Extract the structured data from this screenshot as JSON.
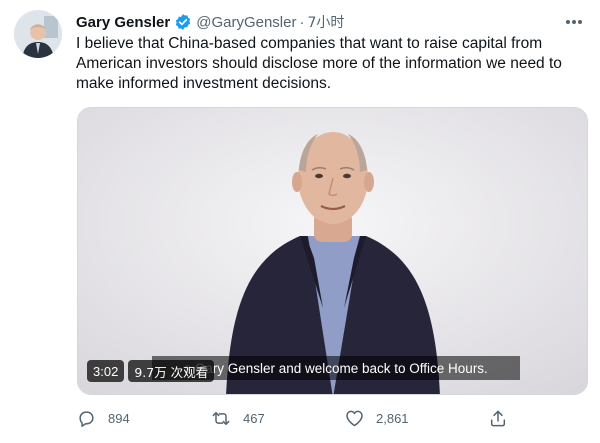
{
  "author": {
    "name": "Gary Gensler",
    "handle": "@GaryGensler",
    "separator": "·",
    "time": "7小时",
    "verified": true
  },
  "tweet": {
    "text": "I believe that China-based companies that want to raise capital from American investors should disclose more of the information we need to make informed investment decisions."
  },
  "video": {
    "subtitle": "s Gary Gensler and welcome back to Office Hours.",
    "duration": "3:02",
    "views": "9.7万 次观看"
  },
  "actions": {
    "replies": "894",
    "retweets": "467",
    "likes": "2,861"
  },
  "colors": {
    "verified_badge": "#1d9bf0",
    "secondary_text": "#536471",
    "primary_text": "#0f1419"
  },
  "icons": [
    "verified-badge-icon",
    "more-options-icon",
    "reply-icon",
    "retweet-icon",
    "like-icon",
    "share-icon"
  ]
}
